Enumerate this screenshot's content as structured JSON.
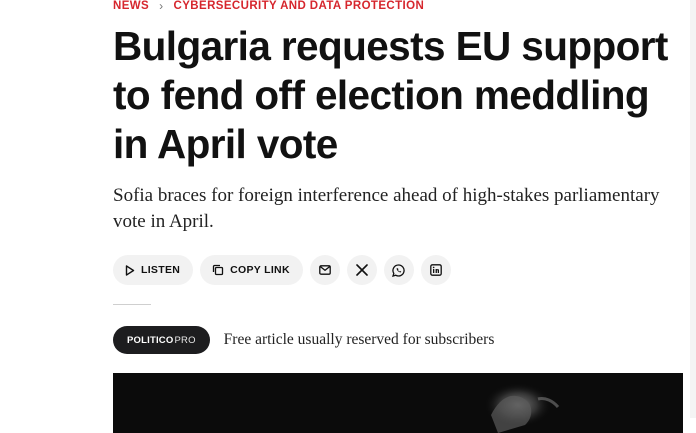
{
  "breadcrumb": {
    "section": "NEWS",
    "separator": "›",
    "topic": "CYBERSECURITY AND DATA PROTECTION"
  },
  "article": {
    "headline": "Bulgaria requests EU support to fend off election meddling in April vote",
    "subhead": "Sofia braces for foreign interference ahead of high-stakes parliamentary vote in April."
  },
  "share": {
    "listen_label": "LISTEN",
    "copy_link_label": "COPY LINK",
    "icons": [
      "play-icon",
      "copy-icon",
      "email-icon",
      "x-icon",
      "whatsapp-icon",
      "linkedin-icon"
    ]
  },
  "pro": {
    "brand": "POLITICO",
    "tier": "PRO",
    "note": "Free article usually reserved for subscribers"
  },
  "colors": {
    "accent": "#d6262d",
    "text": "#111111",
    "pill_bg": "#f2f2f2",
    "badge_bg": "#1d1d1f",
    "hero_bg": "#0b0b0b"
  }
}
